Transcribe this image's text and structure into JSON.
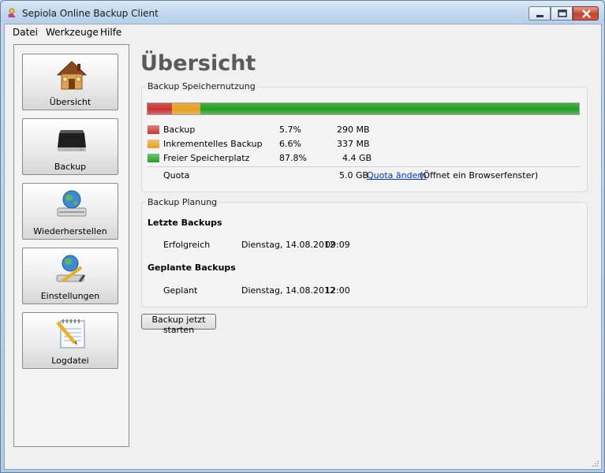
{
  "window": {
    "title": "Sepiola Online Backup Client",
    "minimize_icon": "minimize-icon",
    "maximize_icon": "maximize-icon",
    "close_icon": "close-icon"
  },
  "menubar": {
    "items": [
      "Datei",
      "Werkzeuge",
      "Hilfe"
    ]
  },
  "sidebar": {
    "items": [
      {
        "label": "Übersicht",
        "icon": "house-icon"
      },
      {
        "label": "Backup",
        "icon": "hard-drive-icon"
      },
      {
        "label": "Wiederherstellen",
        "icon": "globe-drive-icon"
      },
      {
        "label": "Einstellungen",
        "icon": "settings-globe-icon"
      },
      {
        "label": "Logdatei",
        "icon": "notepad-icon"
      }
    ]
  },
  "main": {
    "title": "Übersicht",
    "usage": {
      "group_label": "Backup Speichernutzung",
      "rows": [
        {
          "name": "Backup",
          "percent": "5.7%",
          "size": "290 MB",
          "fraction": 0.057,
          "color": "#cc3333"
        },
        {
          "name": "Inkrementelles Backup",
          "percent": "6.6%",
          "size": "337 MB",
          "fraction": 0.066,
          "color": "#e8a020"
        },
        {
          "name": "Freier Speicherplatz",
          "percent": "87.8%",
          "size": "4.4 GB",
          "fraction": 0.878,
          "color": "#22a022"
        }
      ],
      "quota_label": "Quota",
      "quota_value": "5.0 GB",
      "quota_link": "Quota ändern",
      "quota_note": "(Öffnet ein Browserfenster)"
    },
    "schedule": {
      "group_label": "Backup Planung",
      "last_heading": "Letzte Backups",
      "last_status": "Erfolgreich",
      "last_date": "Dienstag, 14.08.2012",
      "last_time": "09:09",
      "planned_heading": "Geplante Backups",
      "planned_status": "Geplant",
      "planned_date": "Dienstag, 14.08.2012",
      "planned_time": "12:00"
    },
    "start_button": "Backup jetzt starten"
  }
}
